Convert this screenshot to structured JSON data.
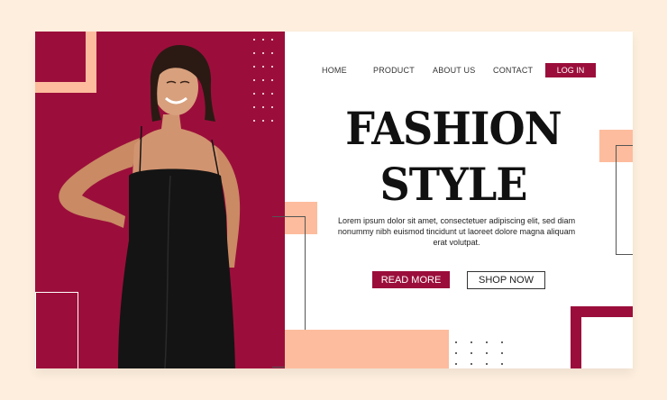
{
  "nav": {
    "items": [
      "HOME",
      "PRODUCT",
      "ABOUT US",
      "CONTACT"
    ],
    "login": "LOG IN"
  },
  "hero": {
    "title_line1": "FASHION",
    "title_line2": "STYLE",
    "body": "Lorem ipsum dolor sit amet, consectetuer adipiscing elit, sed diam nonummy nibh euismod tincidunt ut laoreet dolore magna aliquam erat volutpat.",
    "read_more": "READ MORE",
    "shop_now": "SHOP NOW"
  },
  "colors": {
    "accent": "#9b0e3b",
    "peach": "#fdbc9d",
    "background": "#fdeedd"
  }
}
